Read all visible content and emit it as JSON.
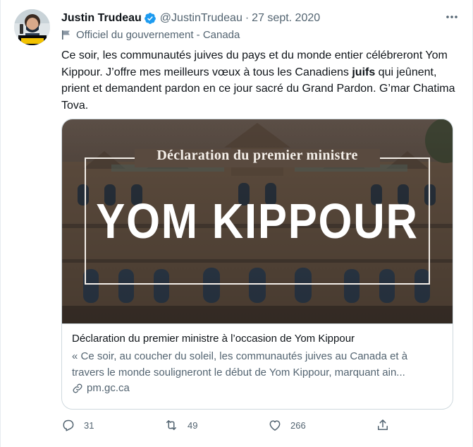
{
  "author": {
    "name": "Justin Trudeau",
    "handle": "@JustinTrudeau",
    "separator": "·",
    "date": "27 sept. 2020",
    "label": "Officiel du gouvernement - Canada"
  },
  "tweet": {
    "text_before": "Ce soir, les communautés juives du pays et du monde entier célébreront Yom Kippour. J’offre mes meilleurs vœux à tous les Canadiens ",
    "text_bold": "juifs",
    "text_after": " qui jeûnent, prient et demandent pardon en ce jour sacré du Grand Pardon. G’mar Chatima Tova."
  },
  "card": {
    "image_subtitle": "Déclaration du premier ministre",
    "image_title": "YOM KIPPOUR",
    "title": "Déclaration du premier ministre à l’occasion de Yom Kippour",
    "description": "« Ce soir, au coucher du soleil, les communautés juives au Canada et à travers le monde souligneront le début de Yom Kippour, marquant ain...",
    "domain": "pm.gc.ca"
  },
  "actions": {
    "reply_count": "31",
    "retweet_count": "49",
    "like_count": "266"
  },
  "colors": {
    "verified": "#1d9bf0",
    "secondary_text": "#536471",
    "border": "#cfd9de"
  },
  "icons": [
    "verified-badge-icon",
    "more-icon",
    "government-flag-icon",
    "link-icon",
    "reply-icon",
    "retweet-icon",
    "like-icon",
    "share-icon"
  ]
}
